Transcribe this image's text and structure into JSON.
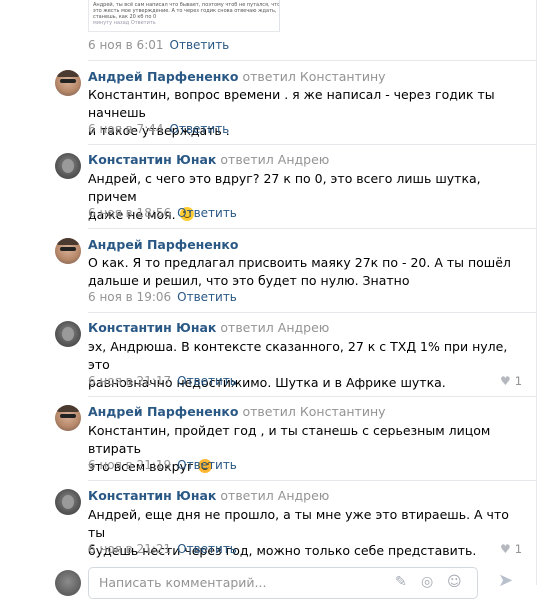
{
  "thumbnail": {
    "lines": [
      "Андрей, ты всё сам написал что бывает, поэтому чтоб не путался, что",
      "это жесть мое утверждение. А то через годик снова отвечаю ждать,",
      "станешь, как 20 кб по 0",
      "минуту назад  Ответить"
    ]
  },
  "first_meta": {
    "time": "6 ноя в 6:01",
    "reply": "Ответить"
  },
  "comments": [
    {
      "author": "Андрей Парфененко",
      "replied": "ответил",
      "to": "Константину",
      "text1": "Константин, вопрос времени . я же написал - через годик ты начнешь",
      "text2": "и такое утверждать .",
      "time": "6 ноя в 7:44",
      "reply": "Ответить"
    },
    {
      "author": "Константин Юнак",
      "replied": "ответил",
      "to": "Андрею",
      "text1": "Андрей, с чего это вдруг? 27 к по 0, это всего лишь шутка, причем",
      "text2": "даже не моя.",
      "emoji": "smile-emoji",
      "time": "6 ноя в 18:56",
      "reply": "Ответить"
    },
    {
      "author": "Андрей Парфененко",
      "text1": "О как. Я то предлагал присвоить маяку 27к по - 20. А ты пошёл",
      "text2": "дальше и решил, что это будет по нулю. Знатно",
      "time": "6 ноя в 19:06",
      "reply": "Ответить"
    },
    {
      "author": "Константин Юнак",
      "replied": "ответил",
      "to": "Андрею",
      "text1": "эх, Андрюша. В контексте сказанного, 27 к с ТХД 1% при нуле, это",
      "text2": "равнозначно недостижимо. Шутка и в Африке шутка.",
      "time": "6 ноя в 21:17",
      "reply": "Ответить",
      "likes": "1"
    },
    {
      "author": "Андрей Парфененко",
      "replied": "ответил",
      "to": "Константину",
      "text1": "Константин, пройдет год , и ты станешь с серьезным лицом втирать",
      "text2": "это всем вокруг",
      "emoji": "laughing-emoji",
      "time": "6 ноя в 21:19",
      "reply": "Ответить"
    },
    {
      "author": "Константин Юнак",
      "replied": "ответил",
      "to": "Андрею",
      "text1": "Андрей, еще дня не прошло, а ты мне уже это втираешь. А что ты",
      "text2": "будешь нести через год, можно только себе представить.",
      "time": "6 ноя в 21:21",
      "reply": "Ответить",
      "likes": "1"
    }
  ],
  "compose": {
    "placeholder": "Написать комментарий..."
  }
}
